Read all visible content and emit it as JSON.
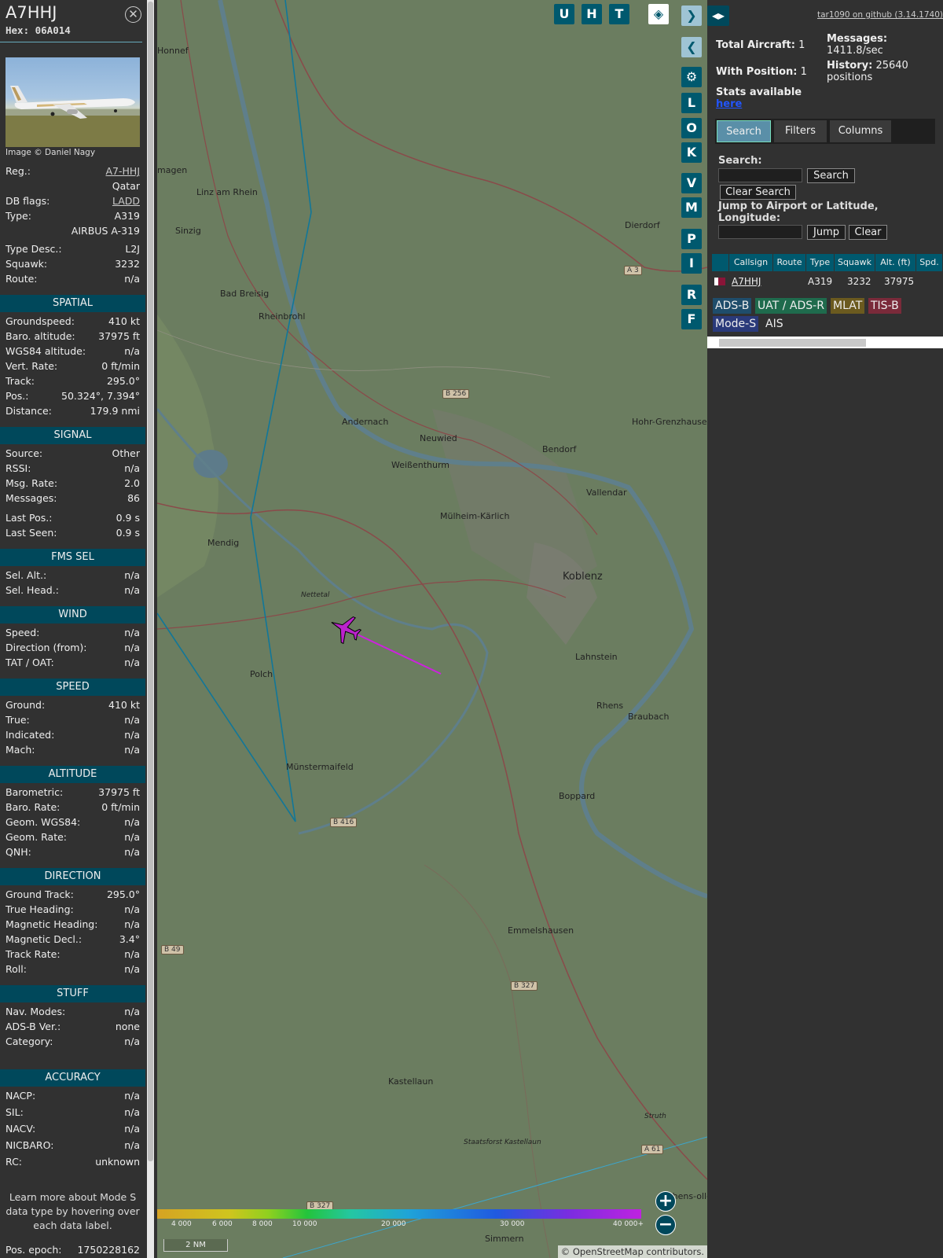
{
  "aircraft": {
    "title": "A7HHJ",
    "hex": "Hex: 06A014",
    "image_credit": "Image © Daniel Nagy",
    "reg_label": "Reg.:",
    "reg_value": "A7-HHJ",
    "country": "Qatar",
    "dbflags_label": "DB flags:",
    "dbflags_value": "LADD",
    "type_label": "Type:",
    "type_value": "A319",
    "type_name": "AIRBUS A-319",
    "typedesc_label": "Type Desc.:",
    "typedesc_value": "L2J",
    "squawk_label": "Squawk:",
    "squawk_value": "3232",
    "route_label": "Route:",
    "route_value": "n/a"
  },
  "sections": {
    "spatial": "SPATIAL",
    "signal": "SIGNAL",
    "fms": "FMS SEL",
    "wind": "WIND",
    "speed": "SPEED",
    "altitude": "ALTITUDE",
    "direction": "DIRECTION",
    "stuff": "STUFF",
    "accuracy": "ACCURACY"
  },
  "spatial": [
    [
      "Groundspeed:",
      "410 kt"
    ],
    [
      "Baro. altitude:",
      "37975 ft"
    ],
    [
      "WGS84 altitude:",
      "n/a"
    ],
    [
      "Vert. Rate:",
      "0 ft/min"
    ],
    [
      "Track:",
      "295.0°"
    ],
    [
      "Pos.:",
      "50.324°, 7.394°"
    ],
    [
      "Distance:",
      "179.9 nmi"
    ]
  ],
  "signal": [
    [
      "Source:",
      "Other"
    ],
    [
      "RSSI:",
      "n/a"
    ],
    [
      "Msg. Rate:",
      "2.0"
    ],
    [
      "Messages:",
      "86"
    ],
    [
      "Last Pos.:",
      "0.9 s"
    ],
    [
      "Last Seen:",
      "0.9 s"
    ]
  ],
  "fms": [
    [
      "Sel. Alt.:",
      "n/a"
    ],
    [
      "Sel. Head.:",
      "n/a"
    ]
  ],
  "wind": [
    [
      "Speed:",
      "n/a"
    ],
    [
      "Direction (from):",
      "n/a"
    ],
    [
      "TAT / OAT:",
      "n/a"
    ]
  ],
  "speed": [
    [
      "Ground:",
      "410 kt"
    ],
    [
      "True:",
      "n/a"
    ],
    [
      "Indicated:",
      "n/a"
    ],
    [
      "Mach:",
      "n/a"
    ]
  ],
  "altitude": [
    [
      "Barometric:",
      "37975 ft"
    ],
    [
      "Baro. Rate:",
      "0 ft/min"
    ],
    [
      "Geom. WGS84:",
      "n/a"
    ],
    [
      "Geom. Rate:",
      "n/a"
    ],
    [
      "QNH:",
      "n/a"
    ]
  ],
  "direction": [
    [
      "Ground Track:",
      "295.0°"
    ],
    [
      "True Heading:",
      "n/a"
    ],
    [
      "Magnetic Heading:",
      "n/a"
    ],
    [
      "Magnetic Decl.:",
      "3.4°"
    ],
    [
      "Track Rate:",
      "n/a"
    ],
    [
      "Roll:",
      "n/a"
    ]
  ],
  "stuff": [
    [
      "Nav. Modes:",
      "n/a"
    ],
    [
      "ADS-B Ver.:",
      "none"
    ],
    [
      "Category:",
      "n/a"
    ]
  ],
  "accuracy": [
    [
      "NACP:",
      "n/a"
    ],
    [
      "SIL:",
      "n/a"
    ],
    [
      "NACV:",
      "n/a"
    ],
    [
      "NICBARO:",
      "n/a"
    ],
    [
      "RC:",
      "unknown"
    ]
  ],
  "note": "Learn more about Mode S data type by hovering over each data label.",
  "epoch_label": "Pos. epoch:",
  "epoch_value": "1750228162",
  "map": {
    "buttons_top": [
      "U",
      "H",
      "T"
    ],
    "buttons_side": [
      "L",
      "O",
      "K",
      "V",
      "M",
      "P",
      "I",
      "R",
      "F"
    ],
    "towns": [
      "Honnef",
      "magen",
      "Linz am Rhein",
      "Sinzig",
      "Dierdorf",
      "Bad Breisig",
      "Rheinbrohl",
      "Andernach",
      "Neuwied",
      "Weißenthurm",
      "Bendorf",
      "Hohr-Grenzhausen",
      "Vallendar",
      "Mülheim-Kärlich",
      "Mendig",
      "Nettetal",
      "Koblenz",
      "Lahnstein",
      "Polch",
      "Rhens",
      "Braubach",
      "Münstermaifeld",
      "Boppard",
      "Emmelshausen",
      "Kastellaun",
      "Staatsforst Kastellaun",
      "Struth",
      "Simmern",
      "Rhens-ollen"
    ],
    "roads": [
      "A 3",
      "B 256",
      "B 416",
      "B 49",
      "B 327",
      "B 327",
      "A 61"
    ],
    "alt_ticks": [
      "4 000",
      "6 000",
      "8 000",
      "10 000",
      "20 000",
      "30 000",
      "40 000+"
    ],
    "scale": "2 NM",
    "attribution": "© OpenStreetMap contributors.",
    "zoom_in": "+",
    "zoom_out": "−"
  },
  "right": {
    "version_link": "tar1090 on github (3.14.1740)",
    "total_label": "Total Aircraft:",
    "total_value": "1",
    "withpos_label": "With Position:",
    "withpos_value": "1",
    "messages_label": "Messages:",
    "messages_value": "1411.8/sec",
    "history_label": "History:",
    "history_value": "25640 positions",
    "stats_text": "Stats available",
    "stats_link": "here",
    "tabs": [
      "Search",
      "Filters",
      "Columns"
    ],
    "search_label": "Search:",
    "search_btn": "Search",
    "clear_search_btn": "Clear Search",
    "jump_label": "Jump to Airport or Latitude, Longitude:",
    "jump_btn": "Jump",
    "clear_btn": "Clear",
    "columns": [
      "Callsign",
      "Route",
      "Type",
      "Squawk",
      "Alt. (ft)",
      "Spd."
    ],
    "row": {
      "callsign": "A7HHJ",
      "route": "",
      "type": "A319",
      "squawk": "3232",
      "alt": "37975"
    },
    "badges": [
      "ADS-B",
      "UAT / ADS-R",
      "MLAT",
      "TIS-B",
      "Mode-S",
      "AIS"
    ],
    "colors": {
      "adsb": "#1f4d6b",
      "uat": "#1f6b4d",
      "mlat": "#6b5a1f",
      "tisb": "#7a2a3a",
      "modes": "#2a3a7a",
      "accent": "#00596e"
    }
  }
}
